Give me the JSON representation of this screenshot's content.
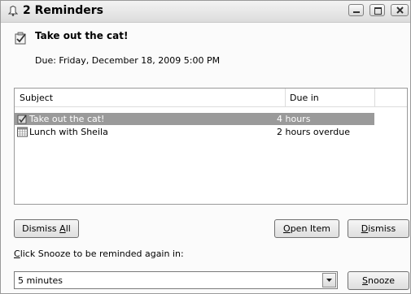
{
  "window": {
    "title": "2 Reminders",
    "controls": [
      "minimize-icon",
      "maximize-icon",
      "close-icon"
    ]
  },
  "header": {
    "subject": "Take out the cat!",
    "due": "Due: Friday, December 18, 2009 5:00 PM",
    "icon": "task-icon"
  },
  "list": {
    "columns": [
      "Subject",
      "Due in"
    ],
    "rows": [
      {
        "subject": "Take out the cat!",
        "due_in": "4 hours",
        "icon": "task-icon",
        "selected": true
      },
      {
        "subject": "Lunch with Sheila",
        "due_in": "2 hours overdue",
        "icon": "calendar-icon",
        "selected": false
      }
    ]
  },
  "buttons": {
    "dismiss_all_pre": "Dismiss ",
    "dismiss_all_key": "A",
    "dismiss_all_post": "ll",
    "open_item_key": "O",
    "open_item_post": "pen Item",
    "dismiss_key": "D",
    "dismiss_post": "ismiss",
    "snooze_key": "S",
    "snooze_post": "nooze"
  },
  "snooze": {
    "label_key": "C",
    "label_post": "lick Snooze to be reminded again in:",
    "selected": "5 minutes"
  },
  "colors": {
    "selection": "#9a9a9a",
    "selection_text": "#ffffff"
  }
}
